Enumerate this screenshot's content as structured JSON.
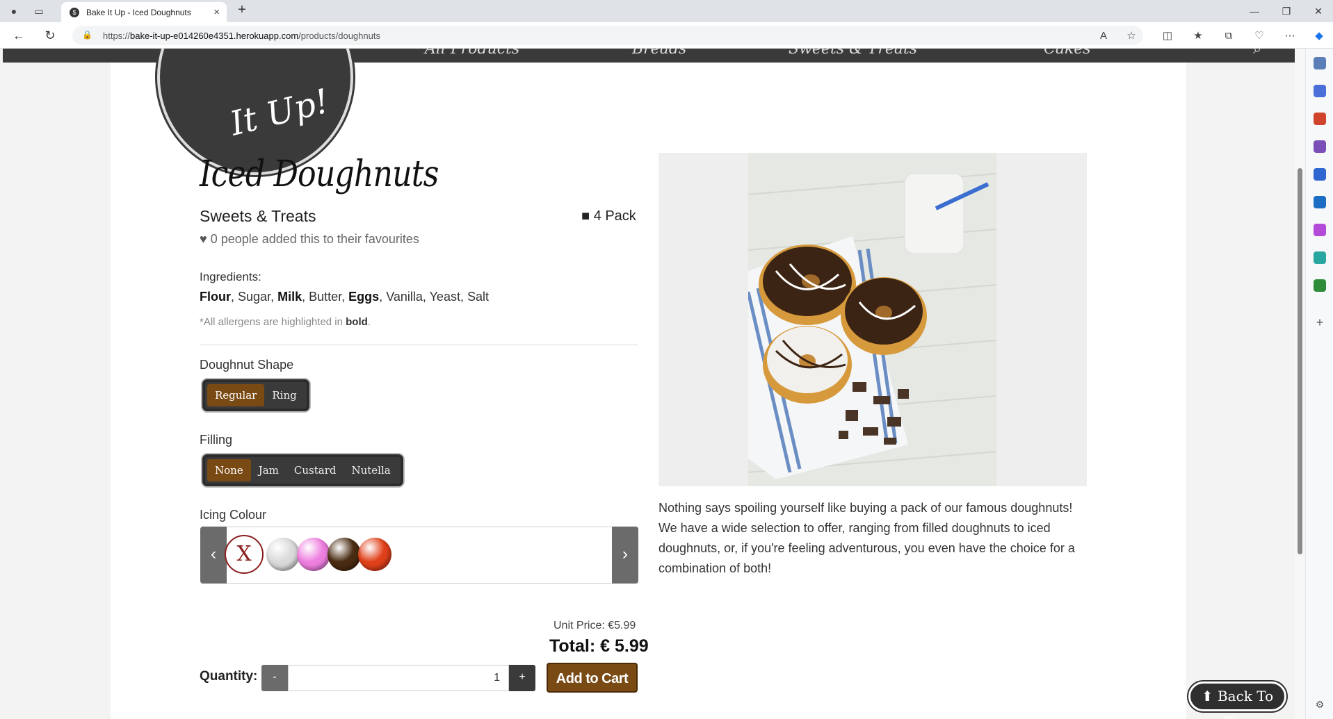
{
  "browser": {
    "tab_title": "Bake It Up - Iced Doughnuts",
    "url_prefix": "https://",
    "url_host": "bake-it-up-e014260e4351.herokuapp.com",
    "url_path": "/products/doughnuts"
  },
  "site": {
    "logo_text": "It Up!",
    "nav": [
      "All Products",
      "Breads",
      "Sweets & Treats",
      "Cakes"
    ]
  },
  "product": {
    "title": "Iced Doughnuts",
    "category": "Sweets & Treats",
    "pack_size": "4 Pack",
    "favourites": "0 people added this to their favourites",
    "ingredients_label": "Ingredients:",
    "ingredients": [
      {
        "name": "Flour",
        "allergen": true
      },
      {
        "name": "Sugar",
        "allergen": false
      },
      {
        "name": "Milk",
        "allergen": true
      },
      {
        "name": "Butter",
        "allergen": false
      },
      {
        "name": "Eggs",
        "allergen": true
      },
      {
        "name": "Vanilla",
        "allergen": false
      },
      {
        "name": "Yeast",
        "allergen": false
      },
      {
        "name": "Salt",
        "allergen": false
      }
    ],
    "allergen_note_prefix": "*All allergens are highlighted in",
    "allergen_note_bold": "bold",
    "allergen_note_suffix": ".",
    "description": "Nothing says spoiling yourself like buying a pack of our famous doughnuts! We have a wide selection to offer, ranging from filled doughnuts to iced doughnuts, or, if you're feeling adventurous, you even have the choice for a combination of both!"
  },
  "options": {
    "shape": {
      "label": "Doughnut Shape",
      "choices": [
        "Regular",
        "Ring"
      ],
      "selected": "Regular"
    },
    "filling": {
      "label": "Filling",
      "choices": [
        "None",
        "Jam",
        "Custard",
        "Nutella"
      ],
      "selected": "None"
    },
    "icing": {
      "label": "Icing Colour",
      "none_mark": "X",
      "swatches": [
        {
          "name": "none",
          "color": "#ffffff"
        },
        {
          "name": "white",
          "color": "#d9d9d9"
        },
        {
          "name": "pink",
          "color": "#ee7fe0"
        },
        {
          "name": "chocolate",
          "color": "#4a2c12"
        },
        {
          "name": "orange",
          "color": "#e0401a"
        }
      ]
    }
  },
  "pricing": {
    "unit_price": "Unit Price: €5.99",
    "total": "Total: € 5.99"
  },
  "cart": {
    "quantity_label": "Quantity:",
    "minus": "-",
    "plus": "+",
    "quantity": "1",
    "add_label": "Add to Cart"
  },
  "back_to_top": "Back To Top",
  "colors": {
    "brand_brown": "#7a4a14",
    "dark": "#3a3a3a"
  }
}
